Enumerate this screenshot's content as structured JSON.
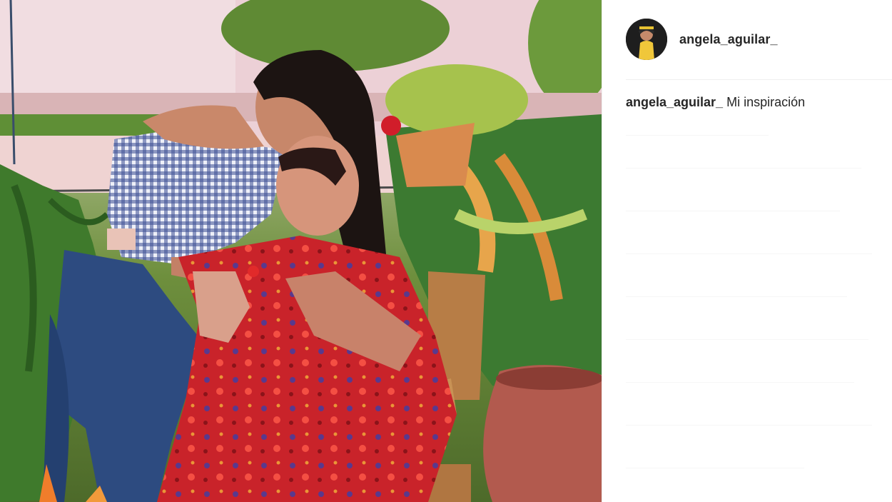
{
  "post": {
    "author": {
      "username": "angela_aguilar_",
      "avatar_icon": "profile-avatar-icon"
    },
    "caption": {
      "username": "angela_aguilar_",
      "text": "Mi inspiración"
    }
  },
  "colors": {
    "text_primary": "#262626",
    "divider": "#efefef",
    "background": "#ffffff"
  }
}
